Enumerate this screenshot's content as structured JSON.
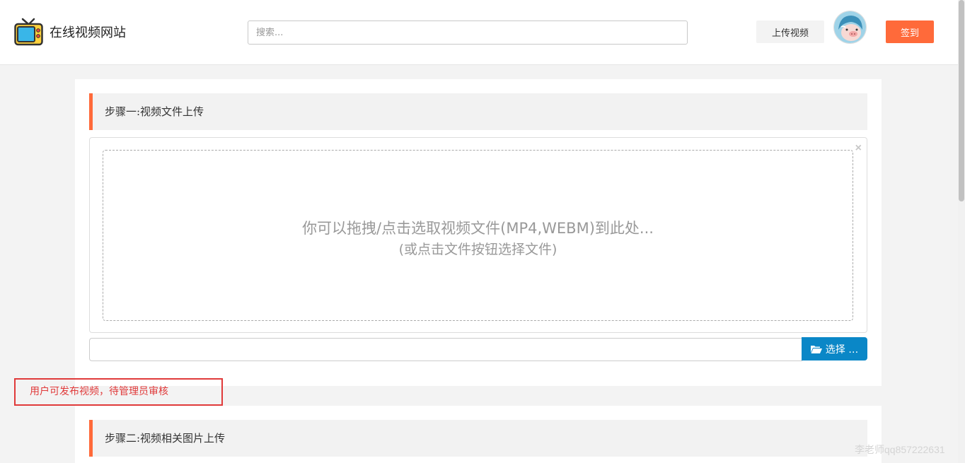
{
  "header": {
    "site_name": "在线视频网站",
    "search_placeholder": "搜索...",
    "upload_label": "上传视频",
    "signin_label": "签到"
  },
  "step1": {
    "title": "步骤一:视频文件上传",
    "drop_text_line1": "你可以拖拽/点击选取视频文件(MP4,WEBM)到此处...",
    "drop_text_line2": "(或点击文件按钮选择文件)",
    "close_glyph": "×",
    "choose_label": "选择 …"
  },
  "annotation": {
    "text": "用户可发布视频，待管理员审核"
  },
  "step2": {
    "title": "步骤二:视频相关图片上传"
  },
  "watermark": {
    "text": "李老师qq857222631"
  },
  "colors": {
    "accent": "#ff6a3a",
    "primary_button": "#0a87c7",
    "annotation": "#e03a3a"
  }
}
